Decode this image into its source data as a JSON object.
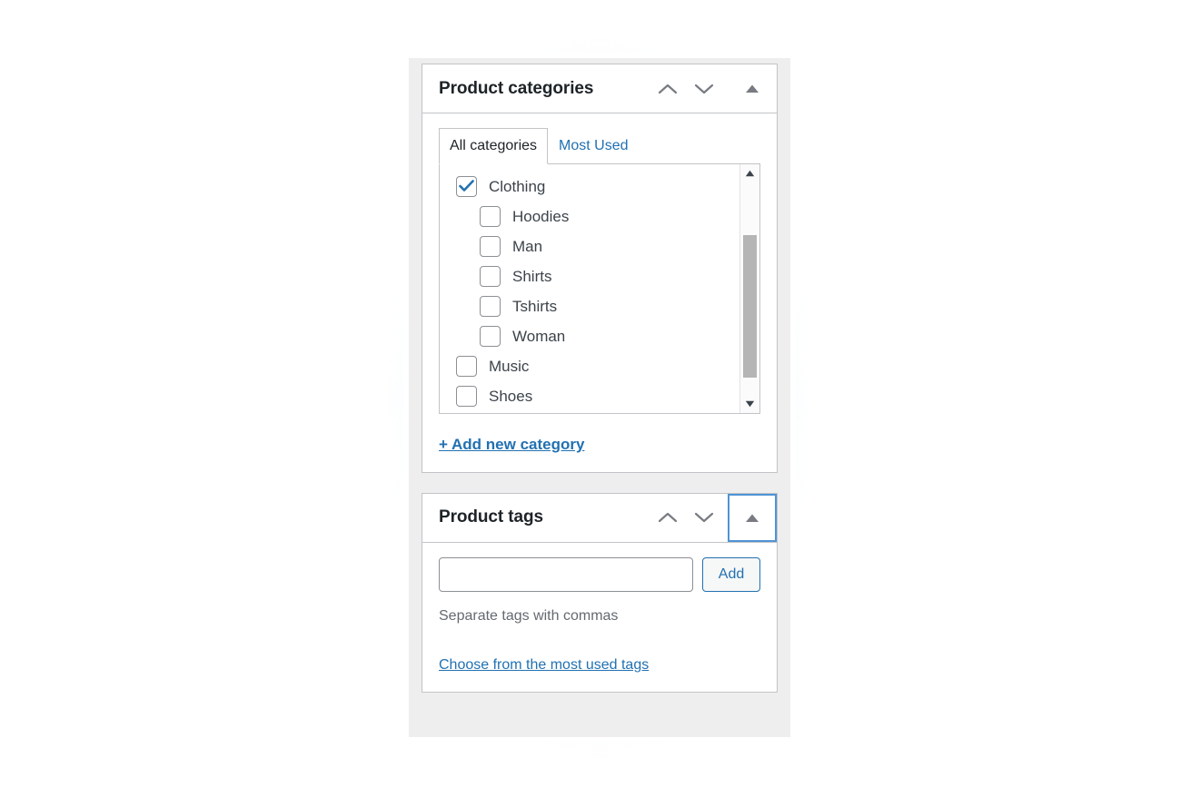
{
  "categories_box": {
    "title": "Product categories",
    "move_up_icon": "chevron-up-icon",
    "move_down_icon": "chevron-down-icon",
    "toggle_icon": "triangle-up-icon",
    "tabs": [
      {
        "label": "All categories",
        "active": true
      },
      {
        "label": "Most Used",
        "active": false
      }
    ],
    "items": [
      {
        "label": "Clothing",
        "checked": true,
        "child": false
      },
      {
        "label": "Hoodies",
        "checked": false,
        "child": true
      },
      {
        "label": "Man",
        "checked": false,
        "child": true
      },
      {
        "label": "Shirts",
        "checked": false,
        "child": true
      },
      {
        "label": "Tshirts",
        "checked": false,
        "child": true
      },
      {
        "label": "Woman",
        "checked": false,
        "child": true
      },
      {
        "label": "Music",
        "checked": false,
        "child": false
      },
      {
        "label": "Shoes",
        "checked": false,
        "child": false
      }
    ],
    "scrollbar": {
      "up_icon": "scroll-up-arrow-icon",
      "down_icon": "scroll-down-arrow-icon",
      "thumb_top_pct": "25%",
      "thumb_height_pct": "67%"
    },
    "add_new_label": "+ Add new category"
  },
  "tags_box": {
    "title": "Product tags",
    "move_up_icon": "chevron-up-icon",
    "move_down_icon": "chevron-down-icon",
    "toggle_icon": "triangle-up-icon",
    "toggle_focused": true,
    "input_value": "",
    "input_placeholder": "",
    "add_label": "Add",
    "hint": "Separate tags with commas",
    "most_used_label": "Choose from the most used tags"
  },
  "colors": {
    "link": "#2271b1",
    "focus_ring": "#4f94d4",
    "border": "#c3c4c7",
    "text": "#1d2327",
    "muted": "#646970",
    "panel_bg": "#eeeeee",
    "checkbox_check": "#2271b1",
    "glow": "#e0f4fa"
  }
}
